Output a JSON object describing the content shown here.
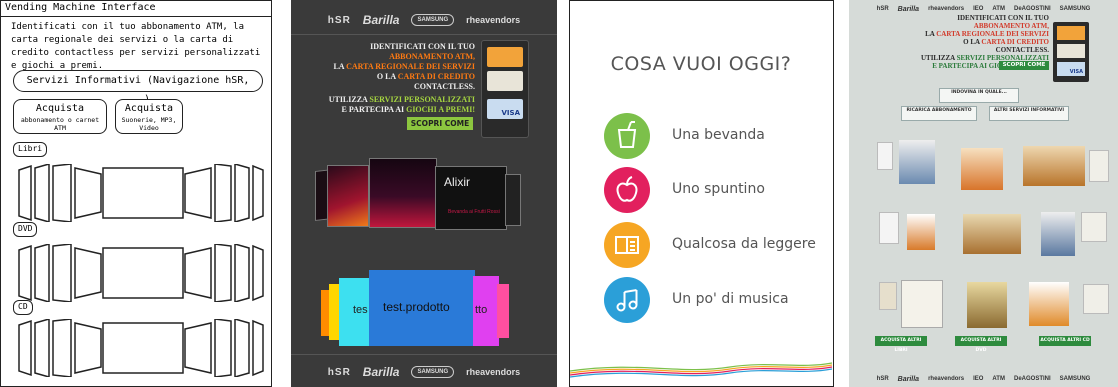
{
  "wireframe": {
    "title": "Vending Machine Interface",
    "intro": "Identificati con il tuo abbonamento ATM, la carta regionale dei servizi o la carta di credito contactless per servizi personalizzati e giochi a premi.",
    "info_button": "Servizi Informativi (Navigazione hSR, ...)",
    "buy1": {
      "label": "Acquista",
      "sub": "abbonamento o carnet ATM"
    },
    "buy2": {
      "label": "Acquista",
      "sub": "Suonerie, MP3, Video"
    },
    "sections": [
      "Libri",
      "DVD",
      "CD"
    ]
  },
  "kiosk": {
    "logos": {
      "hsr": "hSR",
      "barilla": "Barilla",
      "samsung": "SAMSUNG",
      "rhea": "rheavendors"
    },
    "line1": "Identificati con il tuo",
    "line2": "abbonamento ATM,",
    "line3a": "la",
    "line3b": "carta regionale dei servizi",
    "line4a": "o la",
    "line4b": "carta di credito",
    "line5": "contactless.",
    "line6a": "Utilizza",
    "line6b": "servizi personalizzati",
    "line7a": "e partecipa ai",
    "line7b": "giochi a premi!",
    "scopri": "SCOPRI COME",
    "visa": "VISA",
    "product_brand": "Alixir",
    "product_caption": "Bevanda ai Frutti Rossi",
    "coverflow_label": "test.prodotto",
    "coverflow_left": "tes",
    "coverflow_right": "tto"
  },
  "menu": {
    "title": "COSA VUOI OGGI?",
    "items": [
      {
        "label": "Una bevanda",
        "color": "#7cc04a"
      },
      {
        "label": "Uno spuntino",
        "color": "#e2205e"
      },
      {
        "label": "Qualcosa da leggere",
        "color": "#f6a623"
      },
      {
        "label": "Un po' di musica",
        "color": "#2b9fd8"
      }
    ]
  },
  "photo": {
    "logos": [
      "hSR",
      "Barilla",
      "rheavendors",
      "IEO",
      "ATM",
      "DeAGOSTINI",
      "SAMSUNG"
    ],
    "line1": "Identificati con il tuo",
    "line2": "abbonamento ATM,",
    "line3a": "la",
    "line3b": "carta regionale dei servizi",
    "line4a": "o la",
    "line4b": "carta di credito",
    "line5": "contactless.",
    "line6a": "Utilizza",
    "line6b": "servizi personalizzati",
    "line7": "e partecipa ai giochi a premi!",
    "scopri": "SCOPRI COME",
    "visa": "VISA",
    "btn_top": "INDOVINA IN QUALE...",
    "btn_left": "RICARICA ABBONAMENTO",
    "btn_right": "ALTRI SERVIZI INFORMATIVI",
    "bottom_buttons": [
      "ACQUISTA ALTRI LIBRI",
      "ACQUISTA ALTRI DVD",
      "ACQUISTA ALTRI CD"
    ]
  }
}
